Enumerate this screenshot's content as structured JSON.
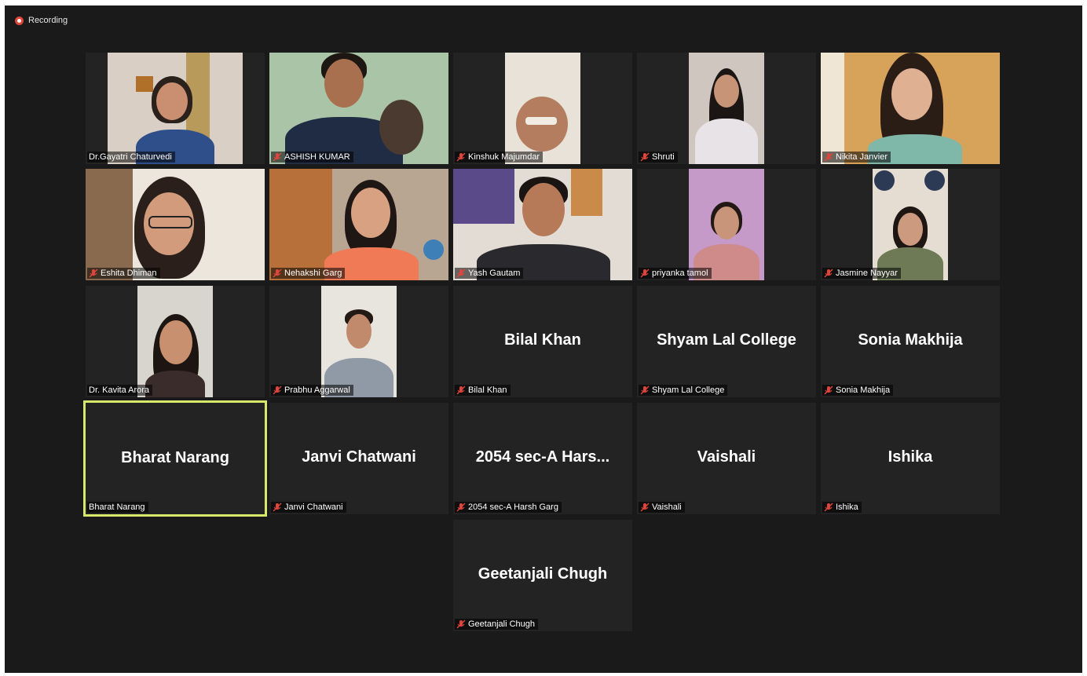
{
  "recording": {
    "label": "Recording"
  },
  "participants": [
    {
      "display_name": "Dr.Gayatri Chaturvedi",
      "muted": false
    },
    {
      "display_name": "ASHISH KUMAR",
      "muted": true
    },
    {
      "display_name": "Kinshuk Majumdar",
      "muted": true
    },
    {
      "display_name": "Shruti",
      "muted": true
    },
    {
      "display_name": "Nikita Janvier",
      "muted": true
    },
    {
      "display_name": "Eshita Dhiman",
      "muted": true
    },
    {
      "display_name": "Nehakshi Garg",
      "muted": true
    },
    {
      "display_name": "Yash Gautam",
      "muted": true
    },
    {
      "display_name": "priyanka tamol",
      "muted": true
    },
    {
      "display_name": "Jasmine Nayyar",
      "muted": true
    },
    {
      "display_name": "Dr. Kavita Arora",
      "muted": false
    },
    {
      "display_name": "Prabhu Aggarwal",
      "muted": true
    },
    {
      "display_name": "Bilal Khan",
      "muted": true,
      "center_name": "Bilal Khan"
    },
    {
      "display_name": "Shyam Lal College",
      "muted": true,
      "center_name": "Shyam Lal College"
    },
    {
      "display_name": "Sonia Makhija",
      "muted": true,
      "center_name": "Sonia Makhija"
    },
    {
      "display_name": "Bharat Narang",
      "muted": false,
      "center_name": "Bharat Narang",
      "active_speaker": true
    },
    {
      "display_name": "Janvi Chatwani",
      "muted": true,
      "center_name": "Janvi Chatwani"
    },
    {
      "display_name": "2054 sec-A Harsh Garg",
      "muted": true,
      "center_name": "2054 sec-A Hars..."
    },
    {
      "display_name": "Vaishali",
      "muted": true,
      "center_name": "Vaishali"
    },
    {
      "display_name": "Ishika",
      "muted": true,
      "center_name": "Ishika"
    },
    {
      "display_name": "Geetanjali Chugh",
      "muted": true,
      "center_name": "Geetanjali Chugh"
    }
  ],
  "icons": {
    "mute": "microphone-muted-icon",
    "recording": "recording-dot-icon"
  },
  "colors": {
    "active_speaker_border": "#d8e86a",
    "mute_icon": "#e0453b",
    "tile_bg": "#232323"
  }
}
